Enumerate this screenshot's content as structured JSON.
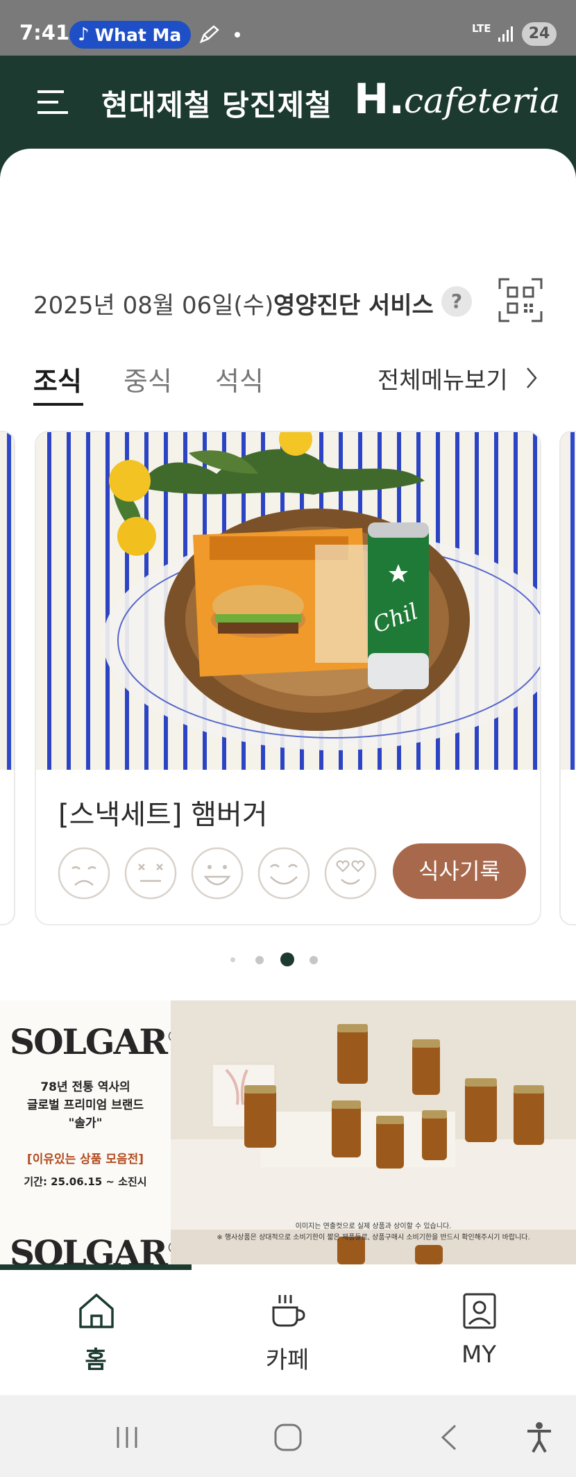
{
  "status_bar": {
    "time": "7:41",
    "media_title": "What Ma",
    "network": "LTE",
    "battery": "24"
  },
  "header": {
    "title": "현대제철 당진제철",
    "logo_h": "H.",
    "logo_cafe": "cafeteria"
  },
  "date_row": {
    "date": "2025년 08월 06일(수)",
    "nutrition_service": "영양진단 서비스",
    "help": "?"
  },
  "tabs": {
    "items": [
      {
        "label": "조식",
        "active": true
      },
      {
        "label": "중식",
        "active": false
      },
      {
        "label": "석식",
        "active": false
      }
    ],
    "full_menu": "전체메뉴보기"
  },
  "menu_card": {
    "name": "[스낵세트] 햄버거",
    "ratings": [
      "sad-face-icon",
      "dizzy-face-icon",
      "grin-face-icon",
      "smile-face-icon",
      "heart-eyes-face-icon"
    ],
    "record_button": "식사기록"
  },
  "carousel": {
    "total_pages": 4,
    "active_page": 3
  },
  "banner": {
    "logo": "SOLGAR",
    "reg": "®",
    "line1": "78년 전통 역사의",
    "line2": "글로벌 프리미엄 브랜드",
    "line3": "\"솔가\"",
    "promo": "[이유있는 상품 모음전]",
    "period": "기간: 25.06.15 ~ 소진시",
    "note1": "이미지는 연출컷으로 실제 상품과 상이할 수 있습니다.",
    "note2": "※ 행사상품은 상대적으로 소비기한이 짧은 제품들로, 상품구매시 소비기한을 반드시 확인해주시기 바랍니다."
  },
  "bottom_nav": {
    "items": [
      {
        "label": "홈",
        "icon": "home-icon",
        "active": true
      },
      {
        "label": "카페",
        "icon": "coffee-cup-icon",
        "active": false
      },
      {
        "label": "MY",
        "icon": "profile-icon",
        "active": false
      }
    ]
  },
  "colors": {
    "primary": "#1c3a30",
    "accent": "#a8684c",
    "status_bar": "#7a7a7a"
  }
}
